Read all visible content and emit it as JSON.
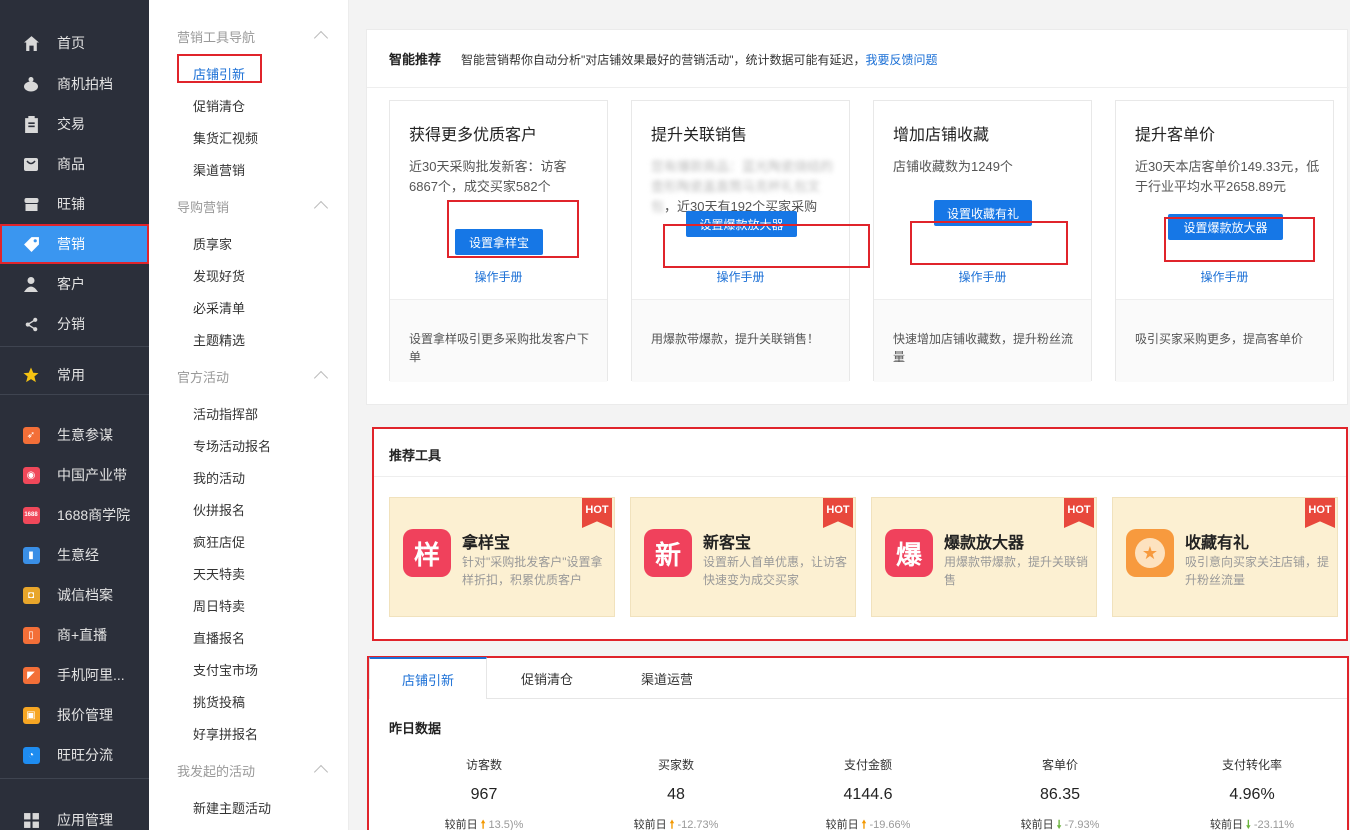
{
  "sidebar": {
    "items": [
      {
        "label": "首页",
        "icon": "home-icon"
      },
      {
        "label": "商机拍档",
        "icon": "handshake-icon"
      },
      {
        "label": "交易",
        "icon": "clipboard-icon"
      },
      {
        "label": "商品",
        "icon": "product-icon"
      },
      {
        "label": "旺铺",
        "icon": "shop-icon"
      },
      {
        "label": "营销",
        "icon": "tag-icon"
      },
      {
        "label": "客户",
        "icon": "user-icon"
      },
      {
        "label": "分销",
        "icon": "share-icon"
      },
      {
        "label": "常用",
        "icon": "star-icon"
      },
      {
        "label": "生意参谋",
        "icon": "compass-icon"
      },
      {
        "label": "中国产业带",
        "icon": "location-icon"
      },
      {
        "label": "1688商学院",
        "icon": "school-icon"
      },
      {
        "label": "生意经",
        "icon": "book-icon"
      },
      {
        "label": "诚信档案",
        "icon": "archive-icon"
      },
      {
        "label": "商+直播",
        "icon": "live-icon"
      },
      {
        "label": "手机阿里...",
        "icon": "mobile-icon"
      },
      {
        "label": "报价管理",
        "icon": "quote-icon"
      },
      {
        "label": "旺旺分流",
        "icon": "wangwang-icon"
      },
      {
        "label": "应用管理",
        "icon": "apps-icon"
      }
    ],
    "colors": {
      "bg": "#2b2f3a",
      "active": "#3a96f0"
    }
  },
  "subnav": {
    "groups": [
      {
        "title": "营销工具导航",
        "items": [
          "店铺引新",
          "促销清仓",
          "集货汇视频",
          "渠道营销"
        ]
      },
      {
        "title": "导购营销",
        "items": [
          "质享家",
          "发现好货",
          "必采清单",
          "主题精选"
        ]
      },
      {
        "title": "官方活动",
        "items": [
          "活动指挥部",
          "专场活动报名",
          "我的活动",
          "伙拼报名",
          "疯狂店促",
          "天天特卖",
          "周日特卖",
          "直播报名",
          "支付宝市场",
          "挑货投稿",
          "好享拼报名"
        ]
      },
      {
        "title": "我发起的活动",
        "items": [
          "新建主题活动"
        ]
      }
    ]
  },
  "smart": {
    "title": "智能推荐",
    "desc": "智能营销帮你自动分析\"对店铺效果最好的营销活动\"，统计数据可能有延迟，",
    "feedback": "我要反馈问题",
    "cards": [
      {
        "title": "获得更多优质客户",
        "desc": "近30天采购批发新客：访客6867个，成交买家582个",
        "blur": "",
        "button": "设置拿样宝",
        "manual": "操作手册",
        "foot": "设置拿样吸引更多采购批发客户下单"
      },
      {
        "title": "提升关联销售",
        "desc": "，近30天有192个买家采购",
        "blur": "您有爆款商品：蓝光陶瓷烧结的壶形陶瓷盖直筒马克杯礼包文包",
        "button": "设置爆款放大器",
        "manual": "操作手册",
        "foot": "用爆款带爆款，提升关联销售！"
      },
      {
        "title": "增加店铺收藏",
        "desc": "店铺收藏数为1249个",
        "blur": "",
        "button": "设置收藏有礼",
        "manual": "操作手册",
        "foot": "快速增加店铺收藏数，提升粉丝流量"
      },
      {
        "title": "提升客单价",
        "desc": "近30天本店客单价149.33元，低于行业平均水平2658.89元",
        "blur": "",
        "button": "设置爆款放大器",
        "manual": "操作手册",
        "foot": "吸引买家采购更多，提高客单价"
      }
    ]
  },
  "tools": {
    "title": "推荐工具",
    "badge": "HOT",
    "items": [
      {
        "glyph": "样",
        "name": "拿样宝",
        "desc": "针对\"采购批发客户\"设置拿样折扣，积累优质客户",
        "color": "#f0415c"
      },
      {
        "glyph": "新",
        "name": "新客宝",
        "desc": "设置新人首单优惠，让访客快速变为成交买家",
        "color": "#f0415c"
      },
      {
        "glyph": "爆",
        "name": "爆款放大器",
        "desc": "用爆款带爆款，提升关联销售",
        "color": "#f0415c"
      },
      {
        "glyph": "★",
        "name": "收藏有礼",
        "desc": "吸引意向买家关注店铺，提升粉丝流量",
        "color": "#f79a3e"
      }
    ]
  },
  "stats": {
    "tabs": [
      "店铺引新",
      "促销清仓",
      "渠道运营"
    ],
    "heading": "昨日数据",
    "compare_label": "较前日",
    "metrics": [
      {
        "label": "访客数",
        "value": "967",
        "dir": "up",
        "change": "13.5)%"
      },
      {
        "label": "买家数",
        "value": "48",
        "dir": "up",
        "change": "-12.73%"
      },
      {
        "label": "支付金额",
        "value": "4144.6",
        "dir": "up",
        "change": "-19.66%"
      },
      {
        "label": "客单价",
        "value": "86.35",
        "dir": "down",
        "change": "-7.93%"
      },
      {
        "label": "支付转化率",
        "value": "4.96%",
        "dir": "down",
        "change": "-23.11%"
      }
    ]
  }
}
